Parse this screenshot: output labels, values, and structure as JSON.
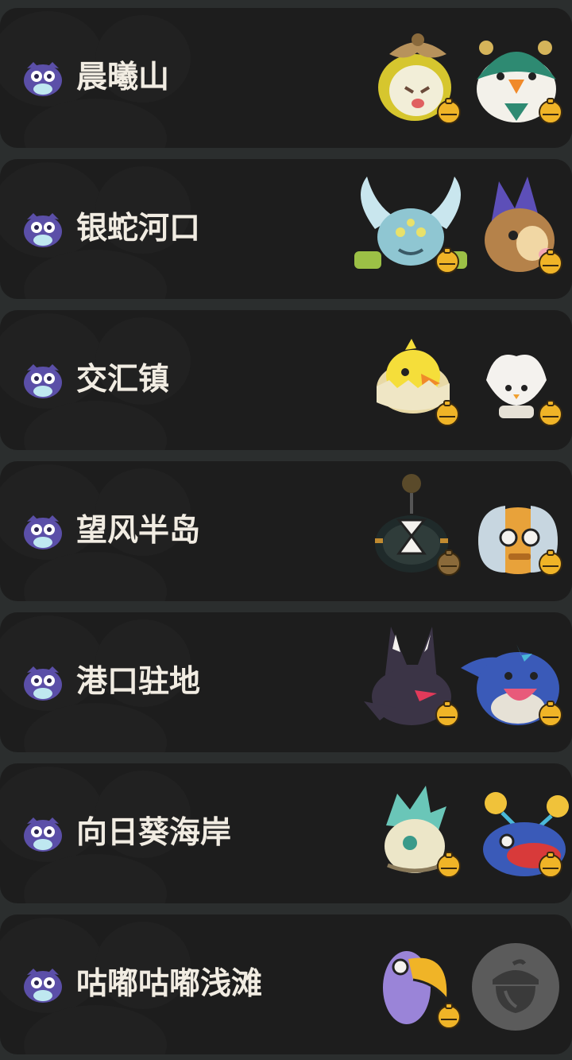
{
  "regions": [
    {
      "name": "晨曦山",
      "pets": [
        "flower-bud-pet-icon",
        "green-leaf-bird-pet-icon"
      ]
    },
    {
      "name": "银蛇河口",
      "pets": [
        "antler-bug-pet-icon",
        "purple-crest-bird-pet-icon"
      ]
    },
    {
      "name": "交汇镇",
      "pets": [
        "hatchling-chick-pet-icon",
        "white-feather-pet-icon"
      ]
    },
    {
      "name": "望风半岛",
      "pets": [
        "hourglass-bomb-pet-icon",
        "robot-orange-pet-icon"
      ]
    },
    {
      "name": "港口驻地",
      "pets": [
        "shadow-fox-pet-icon",
        "blue-fish-pet-icon"
      ]
    },
    {
      "name": "向日葵海岸",
      "pets": [
        "crystal-shell-pet-icon",
        "red-lip-fish-pet-icon"
      ]
    },
    {
      "name": "咕嘟咕嘟浅滩",
      "pets": [
        "toucan-pet-icon",
        "locked-acorn-icon"
      ]
    }
  ],
  "colors": {
    "row_bg": "#1d1d1d",
    "gap_bg": "#2b2e2e",
    "text": "#f1ece2",
    "bell": "#f0b427",
    "owl_icon": "#5b4fa8"
  }
}
